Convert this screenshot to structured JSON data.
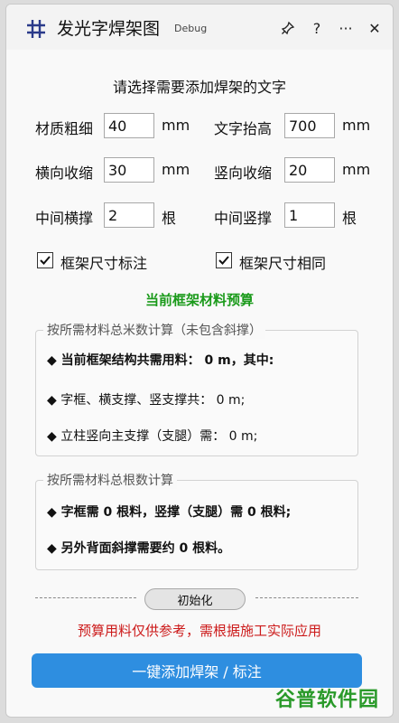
{
  "window": {
    "title": "发光字焊架图",
    "debug_tag": "Debug"
  },
  "titlebar": {
    "pin_icon": "pin-icon",
    "help": "?",
    "more": "···",
    "close": "✕"
  },
  "heading": "请选择需要添加焊架的文字",
  "fields": {
    "material_thickness": {
      "label": "材质粗细",
      "value": "40",
      "unit": "mm"
    },
    "text_raise": {
      "label": "文字抬高",
      "value": "700",
      "unit": "mm"
    },
    "h_shrink": {
      "label": "横向收缩",
      "value": "30",
      "unit": "mm"
    },
    "v_shrink": {
      "label": "竖向收缩",
      "value": "20",
      "unit": "mm"
    },
    "mid_h_brace": {
      "label": "中间横撑",
      "value": "2",
      "unit": "根"
    },
    "mid_v_brace": {
      "label": "中间竖撑",
      "value": "1",
      "unit": "根"
    }
  },
  "checkboxes": {
    "frame_dim": {
      "label": "框架尺寸标注",
      "checked": true
    },
    "frame_same": {
      "label": "框架尺寸相同",
      "checked": true
    }
  },
  "budget_title": "当前框架材料预算",
  "group_meters": {
    "title": "按所需材料总米数计算（未包含斜撑）",
    "line1": "当前框架结构共需用料： 0 m，其中:",
    "line2": "字框、横支撑、竖支撑共： 0 m;",
    "line3": "立柱竖向主支撑（支腿）需： 0 m;"
  },
  "group_count": {
    "title": "按所需材料总根数计算",
    "line1": "字框需 0 根料，竖撑（支腿）需 0 根料;",
    "line2": "另外背面斜撑需要约 0 根料。"
  },
  "init_button": "初始化",
  "warning": "预算用料仅供参考，需根据施工实际应用",
  "main_button": "一键添加焊架 / 标注",
  "watermark_text": "谷普软件园",
  "colors": {
    "accent": "#2e8ee0",
    "success": "#1a9a1a",
    "warning": "#cc1a1a"
  }
}
